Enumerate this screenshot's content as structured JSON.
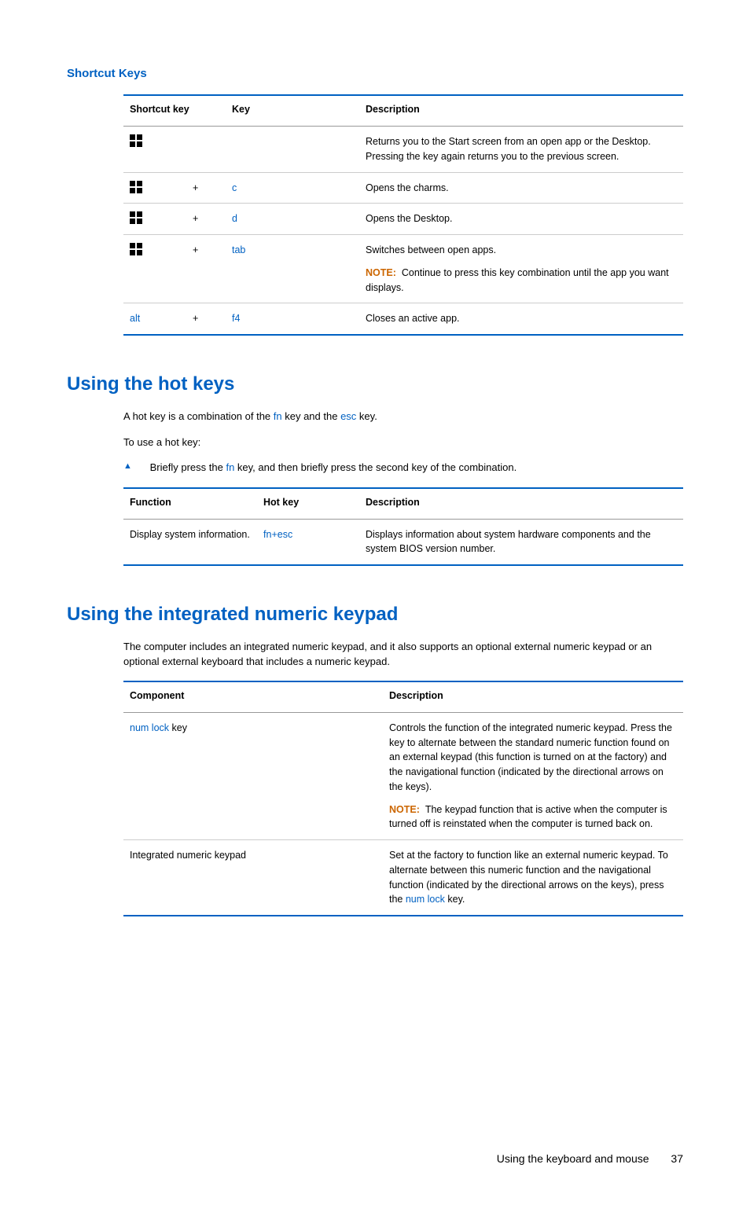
{
  "section1": {
    "title": "Shortcut Keys",
    "headers": [
      "Shortcut key",
      "",
      "Key",
      "Description"
    ],
    "rows": [
      {
        "icon": true,
        "plus": "",
        "key": "",
        "desc": "Returns you to the Start screen from an open app or the Desktop. Pressing the key again returns you to the previous screen."
      },
      {
        "icon": true,
        "plus": "+",
        "key": "c",
        "desc": "Opens the charms."
      },
      {
        "icon": true,
        "plus": "+",
        "key": "d",
        "desc": "Opens the Desktop."
      },
      {
        "icon": true,
        "plus": "+",
        "key": "tab",
        "desc": "Switches between open apps.",
        "noteLabel": "NOTE:",
        "note": "Continue to press this key combination until the app you want displays."
      },
      {
        "icon": false,
        "alt": "alt",
        "plus": "+",
        "key": "f4",
        "desc": "Closes an active app."
      }
    ]
  },
  "section2": {
    "title": "Using the hot keys",
    "intro1a": "A hot key is a combination of the ",
    "intro1_fn": "fn",
    "intro1b": " key and the ",
    "intro1_esc": "esc",
    "intro1c": " key.",
    "intro2": "To use a hot key:",
    "bulletA": "Briefly press the ",
    "bullet_fn": "fn",
    "bulletB": " key, and then briefly press the second key of the combination.",
    "headers": [
      "Function",
      "Hot key",
      "Description"
    ],
    "row": {
      "func": "Display system information.",
      "hotkey_a": "fn",
      "hotkey_plus": "+",
      "hotkey_b": "esc",
      "desc": "Displays information about system hardware components and the system BIOS version number."
    }
  },
  "section3": {
    "title": "Using the integrated numeric keypad",
    "intro": "The computer includes an integrated numeric keypad, and it also supports an optional external numeric keypad or an optional external keyboard that includes a numeric keypad.",
    "headers": [
      "Component",
      "Description"
    ],
    "rows": [
      {
        "comp_key": "num lock",
        "comp_suffix": " key",
        "desc": "Controls the function of the integrated numeric keypad. Press the key to alternate between the standard numeric function found on an external keypad (this function is turned on at the factory) and the navigational function (indicated by the directional arrows on the keys).",
        "noteLabel": "NOTE:",
        "note": "The keypad function that is active when the computer is turned off is reinstated when the computer is turned back on."
      },
      {
        "comp": "Integrated numeric keypad",
        "desc_a": "Set at the factory to function like an external numeric keypad. To alternate between this numeric function and the navigational function (indicated by the directional arrows on the keys), press the ",
        "desc_key": "num lock",
        "desc_b": " key."
      }
    ]
  },
  "footer": {
    "text": "Using the keyboard and mouse",
    "page": "37"
  }
}
